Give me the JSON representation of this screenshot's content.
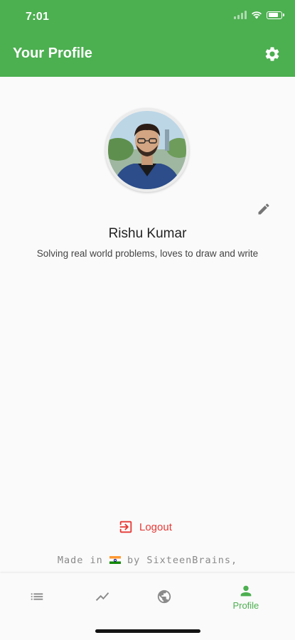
{
  "status_bar": {
    "time": "7:01",
    "battery_level": 0.85
  },
  "app_bar": {
    "title": "Your Profile",
    "action_icon": "gear-icon"
  },
  "profile": {
    "name": "Rishu Kumar",
    "bio": "Solving real world problems, loves to draw and write",
    "edit_icon": "pencil-icon"
  },
  "logout": {
    "label": "Logout",
    "icon": "logout-icon",
    "color": "#e53935"
  },
  "footer": {
    "prefix": "Made in",
    "suffix": "by SixteenBrains,"
  },
  "bottom_nav": {
    "items": [
      {
        "icon": "list-icon",
        "label": "",
        "active": false
      },
      {
        "icon": "trending-icon",
        "label": "",
        "active": false
      },
      {
        "icon": "globe-icon",
        "label": "",
        "active": false
      },
      {
        "icon": "person-icon",
        "label": "Profile",
        "active": true
      }
    ],
    "active_color": "#4caf50",
    "inactive_color": "#8a8a8a"
  },
  "colors": {
    "primary": "#4caf50",
    "background": "#fafafa"
  }
}
